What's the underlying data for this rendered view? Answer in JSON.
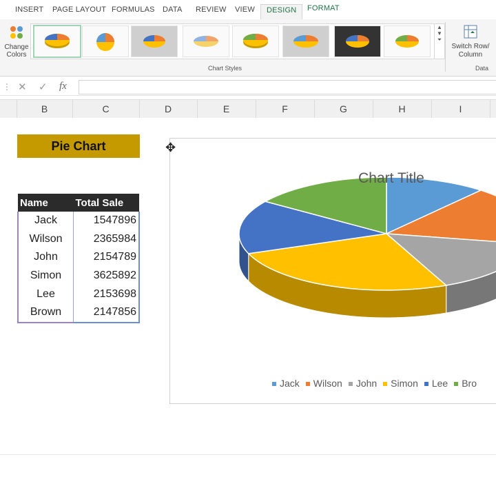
{
  "ribbon_tabs": [
    {
      "label": "INSERT"
    },
    {
      "label": "PAGE LAYOUT"
    },
    {
      "label": "FORMULAS"
    },
    {
      "label": "DATA"
    },
    {
      "label": "REVIEW"
    },
    {
      "label": "VIEW"
    },
    {
      "label": "DESIGN",
      "active": true
    },
    {
      "label": "FORMAT"
    }
  ],
  "ribbon": {
    "change_colors_line1": "Change",
    "change_colors_line2": "Colors",
    "chart_styles_label": "Chart Styles",
    "switch_line1": "Switch Row/",
    "switch_line2": "Column",
    "data_group_label": "Data"
  },
  "formula_bar": {
    "cancel_icon": "cancel-x-icon",
    "enter_icon": "checkmark-icon",
    "function_label": "fx",
    "value": ""
  },
  "columns": [
    "B",
    "C",
    "D",
    "E",
    "F",
    "G",
    "H",
    "I"
  ],
  "sheet": {
    "banner": "Pie Chart",
    "table": {
      "headers": [
        "Name",
        "Total Sale"
      ],
      "rows": [
        [
          "Jack",
          "1547896"
        ],
        [
          "Wilson",
          "2365984"
        ],
        [
          "John",
          "2154789"
        ],
        [
          "Simon",
          "3625892"
        ],
        [
          "Lee",
          "2153698"
        ],
        [
          "Brown",
          "2147856"
        ]
      ]
    }
  },
  "chart_data": {
    "type": "pie",
    "title": "Chart Title",
    "style": "3d-pie",
    "categories": [
      "Jack",
      "Wilson",
      "John",
      "Simon",
      "Lee",
      "Brown"
    ],
    "values": [
      1547896,
      2365984,
      2154789,
      3625892,
      2153698,
      2147856
    ],
    "colors": [
      "#5b9bd5",
      "#ed7d31",
      "#a5a5a5",
      "#ffc000",
      "#4472c4",
      "#70ad47"
    ],
    "legend": "bottom",
    "legend_labels": [
      "Jack",
      "Wilson",
      "John",
      "Simon",
      "Lee",
      "Bro"
    ]
  },
  "colors": {
    "accent": "#217346",
    "banner": "#c49a00",
    "table_header": "#2b2b2b"
  }
}
